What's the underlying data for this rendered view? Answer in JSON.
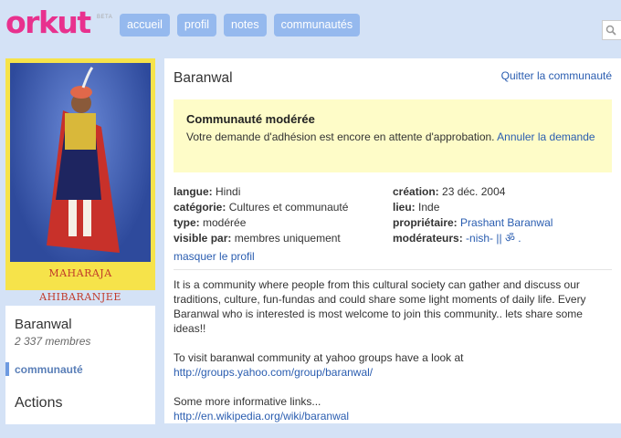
{
  "header": {
    "logo": "orkut",
    "beta": "BETA",
    "nav": [
      "accueil",
      "profil",
      "notes",
      "communautés"
    ],
    "search_icon": "search-icon"
  },
  "community": {
    "name": "Baranwal",
    "members": "2 337 membres",
    "photo_caption": "MAHARAJA AHIBARANJEE",
    "quit": "Quitter la communauté",
    "moderated": {
      "title": "Communauté modérée",
      "message": "Votre demande d'adhésion est encore en attente d'approbation.",
      "cancel": "Annuler la demande"
    },
    "props_left": [
      {
        "label": "langue:",
        "value": "Hindi"
      },
      {
        "label": "catégorie:",
        "value": "Cultures et communauté"
      },
      {
        "label": "type:",
        "value": "modérée"
      },
      {
        "label": "visible par:",
        "value": "membres uniquement"
      }
    ],
    "props_right": [
      {
        "label": "création:",
        "value": "23 déc. 2004"
      },
      {
        "label": "lieu:",
        "value": "Inde"
      },
      {
        "label": "propriétaire:",
        "value": "Prashant Baranwal",
        "link": true
      },
      {
        "label": "modérateurs:",
        "value": "-nish- || ॐ .",
        "link": true
      }
    ],
    "hide_profile": "masquer le profil",
    "description": {
      "p1": "It is a community where people from this cultural society can gather and discuss our traditions, culture, fun-fundas and could share some light moments of daily life. Every Baranwal who is interested is most welcome to join this community.. lets share some ideas!!",
      "p2_text": "To visit baranwal community at yahoo groups have a look at ",
      "p2_link": "http://groups.yahoo.com/group/baranwal/",
      "p3_text": "Some more informative links...",
      "p3_link": "http://en.wikipedia.org/wiki/baranwal"
    }
  },
  "sidebar": {
    "selected": "communauté",
    "actions": "Actions"
  },
  "colors": {
    "logo": "#e8318e",
    "nav_button": "#95b9ee",
    "background": "#d4e2f6",
    "notice": "#fefcc8",
    "link": "#2a5db0"
  }
}
